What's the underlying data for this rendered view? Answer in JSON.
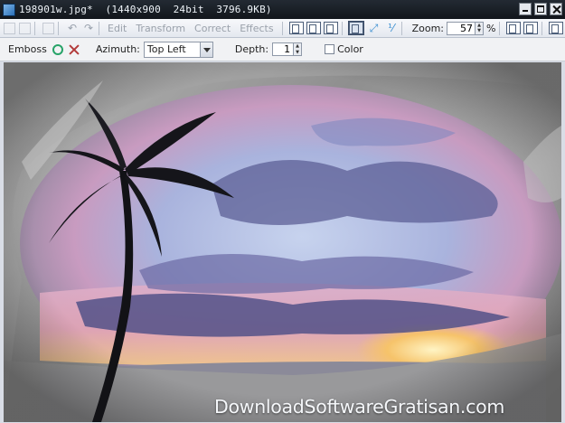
{
  "window": {
    "title": "198901w.jpg*  (1440x900  24bit  3796.9KB)",
    "controls": [
      "minimize-icon",
      "maximize-icon",
      "close-icon"
    ]
  },
  "toolbar": {
    "menus": {
      "edit": "Edit",
      "transform": "Transform",
      "correct": "Correct",
      "effects": "Effects"
    },
    "zoom_label": "Zoom:",
    "zoom_value": "57",
    "zoom_unit": "%"
  },
  "effect_options": {
    "effect_name": "Emboss",
    "azimuth_label": "Azimuth:",
    "azimuth_value": "Top Left",
    "depth_label": "Depth:",
    "depth_value": "1",
    "color_label": "Color",
    "color_checked": false
  },
  "watermark": "DownloadSoftwareGratisan.com",
  "colors": {
    "titlebar": "#1a1f25",
    "toolbar": "#eef0f4",
    "ok": "#27a368",
    "cancel": "#b23a3a",
    "sky_top": "#9fb0d8",
    "sky_pink": "#d79fbe",
    "sun": "#f6c36a"
  }
}
